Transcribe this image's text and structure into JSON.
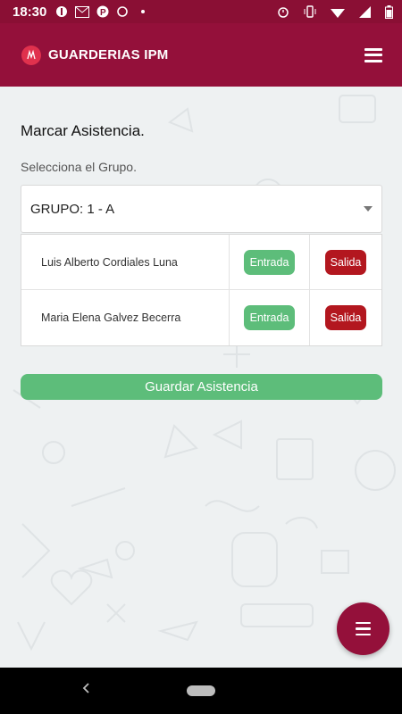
{
  "status_bar": {
    "time": "18:30",
    "icons_left": [
      "lamp-icon",
      "mail-icon",
      "parking-icon",
      "sync-icon",
      "dot"
    ],
    "icons_right": [
      "alarm-icon",
      "vibrate-icon",
      "wifi-icon",
      "signal-icon",
      "battery-icon"
    ]
  },
  "app_bar": {
    "brand": "GUARDERIAS IPM",
    "logo_icon": "ipm-logo-icon",
    "menu_icon": "hamburger-menu-icon"
  },
  "main": {
    "title": "Marcar Asistencia.",
    "group_prompt": "Selecciona el Grupo.",
    "group_select": {
      "value": "GRUPO: 1 - A"
    },
    "students": [
      {
        "name": "Luis Alberto Cordiales Luna",
        "entrada": "Entrada",
        "salida": "Salida"
      },
      {
        "name": "Maria Elena Galvez Becerra",
        "entrada": "Entrada",
        "salida": "Salida"
      }
    ],
    "save_label": "Guardar Asistencia"
  },
  "colors": {
    "primary": "#94103a",
    "status_bar": "#8a0f34",
    "entrada": "#5dbd7a",
    "salida": "#b3171f",
    "background": "#eef1f2"
  },
  "fab": {
    "icon": "menu-icon"
  }
}
